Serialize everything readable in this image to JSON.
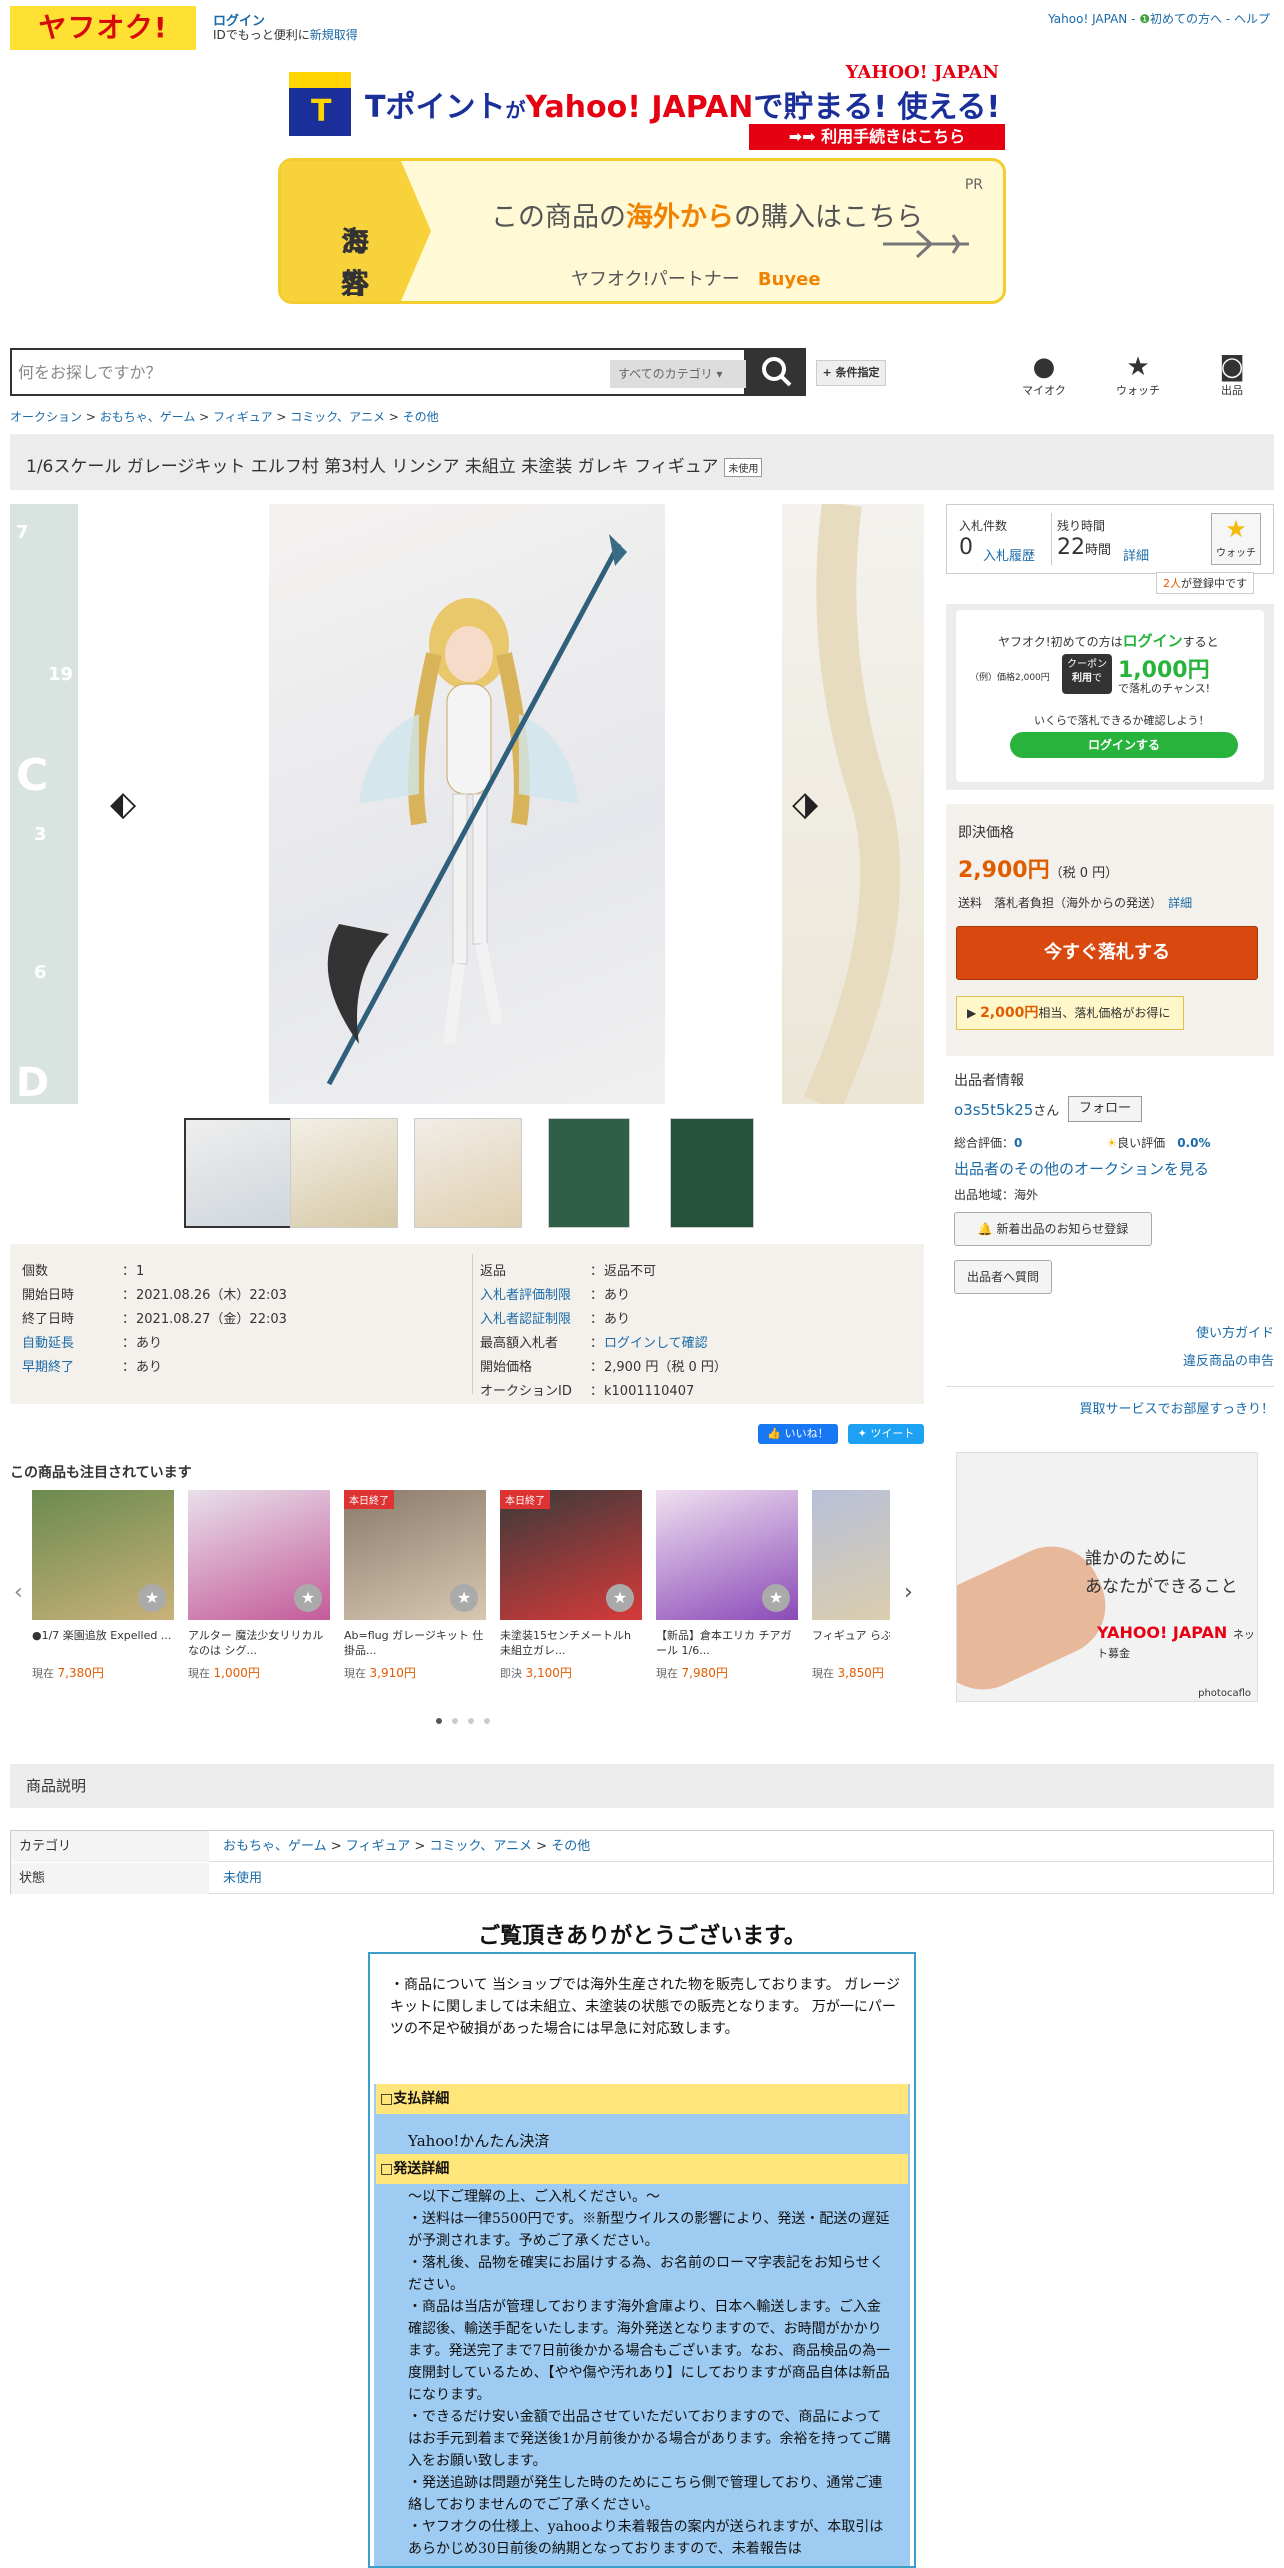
{
  "header": {
    "logo": "ヤフオク!",
    "login_label": "ログイン",
    "id_text": "IDでもっと便利に",
    "signup_label": "新規取得",
    "yahoo_japan": "Yahoo! JAPAN",
    "beginner": "初めての方へ",
    "help": "ヘルプ",
    "sep": " - "
  },
  "tpoint_banner": {
    "t": "T",
    "pre": "Tポイント",
    "ga": "が",
    "yj": "Yahoo! JAPAN",
    "post": "で貯まる! 使える!",
    "logo": "YAHOO! JAPAN",
    "bar": "➡➡ 利用手続きはこちら"
  },
  "overseas_banner": {
    "left_line1": "海外の",
    "left_line2": "お客様へ",
    "main_pre": "この商品の",
    "main_hl": "海外から",
    "main_post": "の購入はこちら",
    "partner_pre": "ヤフオク!パートナー",
    "partner_brand": "Buyee",
    "pr": "PR"
  },
  "search": {
    "placeholder": "何をお探しですか？",
    "category": "すべてのカテゴリ",
    "cond_label": "+ 条件指定"
  },
  "header_icons": {
    "myauc": "マイオク",
    "watch": "ウォッチ",
    "sell": "出品"
  },
  "breadcrumb": [
    "オークション",
    "おもちゃ、ゲーム",
    "フィギュア",
    "コミック、アニメ",
    "その他"
  ],
  "breadcrumb_sep": " > ",
  "title": {
    "text": "1/6スケール ガレージキット エルフ村 第3村人 リンシア 未組立 未塗装 ガレキ フィギュア",
    "badge": "未使用"
  },
  "details": {
    "left": [
      {
        "label": "個数",
        "value": "1",
        "label_link": false
      },
      {
        "label": "開始日時",
        "value": "2021.08.26（木）22:03",
        "label_link": false
      },
      {
        "label": "終了日時",
        "value": "2021.08.27（金）22:03",
        "label_link": false
      },
      {
        "label": "自動延長",
        "value": "あり",
        "label_link": true
      },
      {
        "label": "早期終了",
        "value": "あり",
        "label_link": true
      }
    ],
    "right": [
      {
        "label": "返品",
        "value": "返品不可",
        "label_link": false,
        "value_link": false
      },
      {
        "label": "入札者評価制限",
        "value": "あり",
        "label_link": true,
        "value_link": false
      },
      {
        "label": "入札者認証制限",
        "value": "あり",
        "label_link": true,
        "value_link": false
      },
      {
        "label": "最高額入札者",
        "value": "ログインして確認",
        "label_link": false,
        "value_link": true
      },
      {
        "label": "開始価格",
        "value": "2,900 円（税 0 円）",
        "label_link": false,
        "value_link": false
      },
      {
        "label": "オークションID",
        "value": "k1001110407",
        "label_link": false,
        "value_link": false
      }
    ],
    "colon": "："
  },
  "social": {
    "like": "いいね！",
    "tweet": "ツイート"
  },
  "recommend": {
    "title": "この商品も注目されています",
    "items": [
      {
        "name": "●1/7 楽園追放 Expelled ...",
        "price_label": "現在",
        "price": "7,380円",
        "badge": ""
      },
      {
        "name": "アルター 魔法少女リリカルなのは シグ...",
        "price_label": "現在",
        "price": "1,000円",
        "badge": ""
      },
      {
        "name": "Ab=flug ガレージキット 仕掛品...",
        "price_label": "現在",
        "price": "3,910円",
        "badge": "本日終了"
      },
      {
        "name": "未塗装15センチメートルh 未組立ガレ...",
        "price_label": "即決",
        "price": "3,100円",
        "badge": "本日終了"
      },
      {
        "name": "【新品】倉本エリカ チアガール 1/6...",
        "price_label": "現在",
        "price": "7,980円",
        "badge": ""
      },
      {
        "name": "フィギュア らぶる...",
        "price_label": "現在",
        "price": "3,850円",
        "badge": ""
      }
    ]
  },
  "bid": {
    "count_label": "入札件数",
    "count": "0",
    "history": "入札履歴",
    "remain_label": "残り時間",
    "remain_num": "22",
    "remain_unit": "時間",
    "detail": "詳細",
    "watch_label": "ウォッチ",
    "watch_count_num": "2人",
    "watch_count_text": "が登録中です"
  },
  "promo": {
    "line1_pre": "ヤフオク!初めての方は",
    "line1_link": "ログイン",
    "line1_post": "すると",
    "example": "（例）価格2,000円",
    "coupon_top": "クーポン",
    "coupon_bottom": "利用",
    "coupon_de": "で",
    "amount": "1,000円",
    "chance": "で落札のチャンス!",
    "line3": "いくらで落札できるか確認しよう！",
    "button": "ログインする"
  },
  "price_box": {
    "label": "即決価格",
    "price": "2,900円",
    "tax": "（税 0 円）",
    "ship_label": "送料",
    "ship_value": "落札者負担（海外からの発送）",
    "ship_detail": "詳細",
    "buy": "今すぐ落札する",
    "coupon_amount": "2,000円",
    "coupon_text": "相当、落札価格がお得に"
  },
  "seller": {
    "label": "出品者情報",
    "name": "o3s5t5k25",
    "san": "さん",
    "follow": "フォロー",
    "total_label": "総合評価：",
    "total": "0",
    "good_label": "良い評価",
    "good": "0.0%",
    "others": "出品者のその他のオークションを見る",
    "region": "出品地域：海外",
    "notify": "新着出品のお知らせ登録",
    "ask": "出品者へ質問"
  },
  "side_links": {
    "guide": "使い方ガイド",
    "report": "違反商品の申告",
    "buyback": "買取サービスでお部屋すっきり！"
  },
  "ad": {
    "line1": "誰かのために",
    "line2": "あなたができること",
    "brand": "YAHOO! JAPAN",
    "brand_sub": "ネット募金",
    "credit": "photocaflo"
  },
  "description": {
    "header": "商品説明",
    "rows": [
      {
        "key": "カテゴリ",
        "value": [
          "おもちゃ、ゲーム",
          "フィギュア",
          "コミック、アニメ",
          "その他"
        ]
      },
      {
        "key": "状態",
        "value": [
          "未使用"
        ]
      }
    ],
    "thanks": "ご覧頂きありがとうございます。",
    "intro": "・商品について 当ショップでは海外生産された物を販売しております。 ガレージキットに関しましては未組立、未塗装の状態での販売となります。 万が一にパーツの不足や破損があった場合には早急に対応致します。",
    "pay_head": "□支払詳細",
    "pay_text": "Yahoo!かんたん決済",
    "ship_head": "□発送詳細",
    "ship_lines": [
      "～以下ご理解の上、ご入札ください。～",
      "・送料は一律5500円です。※新型ウイルスの影響により、発送・配送の遅延が予測されます。予めご了承ください。",
      "・落札後、品物を確実にお届けする為、お名前のローマ字表記をお知らせください。",
      "・商品は当店が管理しております海外倉庫より、日本へ輸送します。ご入金確認後、輸送手配をいたします。海外発送となりますので、お時間がかかります。発送完了まで7日前後かかる場合もございます。なお、商品検品の為一度開封しているため、【やや傷や汚れあり】にしておりますが商品自体は新品になります。",
      "・できるだけ安い金額で出品させていただいておりますので、商品によってはお手元到着まで発送後1か月前後かかる場合があります。余裕を持ってご購入をお願い致します。",
      "・発送追跡は問題が発生した時のためにこちら側で管理しており、通常ご連絡しておりませんのでご了承ください。",
      "・ヤフオクの仕様上、yahooより未着報告の案内が送られますが、本取引はあらかじめ30日前後の納期となっておりますので、未着報告は"
    ]
  },
  "colors": {
    "link": "#1a6aa8",
    "price": "#e05c00",
    "buy_button": "#d9480f",
    "logo_bg": "#ffe133",
    "promo_green": "#28b43c"
  }
}
